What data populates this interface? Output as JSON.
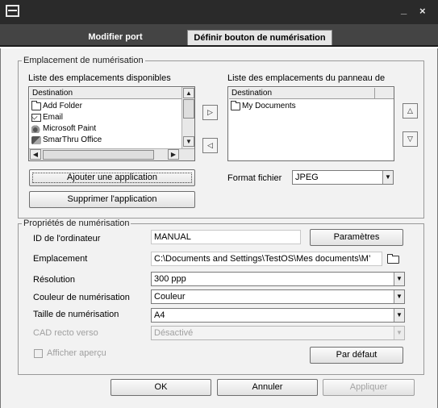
{
  "window": {
    "minimize_glyph": "_",
    "close_glyph": "×"
  },
  "tabs": [
    {
      "label": "Modifier port"
    },
    {
      "label": "Définir bouton de numérisation"
    }
  ],
  "scan_location": {
    "legend": "Emplacement de numérisation",
    "available": {
      "title": "Liste des emplacements disponibles",
      "header": "Destination",
      "items": [
        {
          "label": "Add Folder",
          "icon": "folder-icon"
        },
        {
          "label": "Email",
          "icon": "email-icon"
        },
        {
          "label": "Microsoft Paint",
          "icon": "paint-icon"
        },
        {
          "label": "SmarThru Office",
          "icon": "smarthru-icon"
        }
      ]
    },
    "panel": {
      "title": "Liste des emplacements du panneau de",
      "header": "Destination",
      "items": [
        {
          "label": "My Documents",
          "icon": "folder-icon"
        }
      ]
    },
    "move_right_glyph": "▷",
    "move_left_glyph": "◁",
    "up_glyph": "△",
    "down_glyph": "▽",
    "add_app_label": "Ajouter une application",
    "remove_app_label": "Supprimer l'application",
    "format_label": "Format fichier",
    "format_value": "JPEG"
  },
  "scan_properties": {
    "legend": "Propriétés de numérisation",
    "computer_id_label": "ID de l'ordinateur",
    "computer_id_value": "MANUAL",
    "params_label": "Paramètres",
    "location_label": "Emplacement",
    "location_value": "C:\\Documents and Settings\\TestOS\\Mes documents\\M’",
    "resolution_label": "Résolution",
    "resolution_value": "300 ppp",
    "color_label": "Couleur de numérisation",
    "color_value": "Couleur",
    "size_label": "Taille de numérisation",
    "size_value": "A4",
    "duplex_label": "CAD recto verso",
    "duplex_value": "Désactivé",
    "preview_label": "Afficher aperçu",
    "default_label": "Par défaut"
  },
  "footer": {
    "ok_label": "OK",
    "cancel_label": "Annuler",
    "apply_label": "Appliquer"
  },
  "scroll_glyphs": {
    "up": "▲",
    "down": "▼",
    "left": "◀",
    "right": "▶",
    "combo": "▼"
  }
}
